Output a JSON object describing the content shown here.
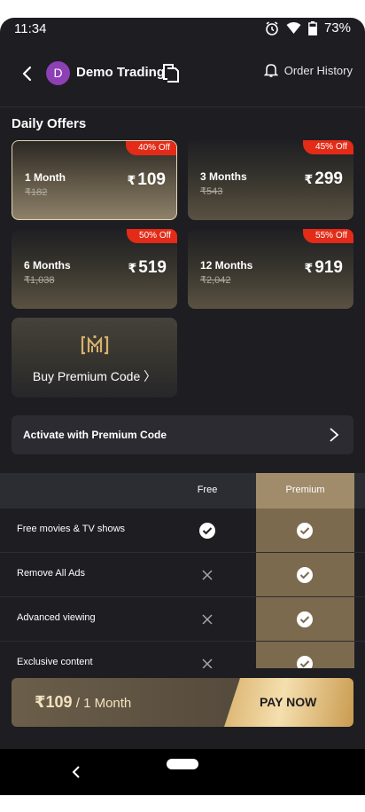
{
  "status_bar": {
    "time": "11:34",
    "battery": "73%"
  },
  "header": {
    "avatar_letter": "D",
    "account_name": "Demo Trading",
    "order_history": "Order History"
  },
  "daily_offers": {
    "title": "Daily Offers",
    "offers": [
      {
        "badge": "40% Off",
        "duration": "1 Month",
        "old_price": "₹182",
        "price": "109",
        "selected": true
      },
      {
        "badge": "45% Off",
        "duration": "3 Months",
        "old_price": "₹543",
        "price": "299",
        "selected": false
      },
      {
        "badge": "50% Off",
        "duration": "6 Months",
        "old_price": "₹1,038",
        "price": "519",
        "selected": false
      },
      {
        "badge": "55% Off",
        "duration": "12 Months",
        "old_price": "₹2,042",
        "price": "919",
        "selected": false
      }
    ],
    "currency_symbol": "₹",
    "buy_premium_code": "Buy Premium Code 〉"
  },
  "activate": {
    "label": "Activate with Premium Code"
  },
  "comparison": {
    "columns": {
      "free": "Free",
      "premium": "Premium"
    },
    "rows": [
      {
        "feature": "Free movies & TV shows",
        "free": true,
        "premium": true
      },
      {
        "feature": "Remove All Ads",
        "free": false,
        "premium": true
      },
      {
        "feature": "Advanced viewing",
        "free": false,
        "premium": true
      },
      {
        "feature": "Exclusive content",
        "free": false,
        "premium": true
      }
    ]
  },
  "pay_bar": {
    "price": "₹109",
    "period": " / 1 Month",
    "button": "PAY NOW"
  },
  "icons": {
    "back": "back-arrow-icon",
    "copy": "copy-icon",
    "bell": "bell-icon",
    "check": "check-circle-icon",
    "cross": "cross-icon",
    "chevron": "chevron-right-icon",
    "premium_logo": "premium-logo-icon",
    "alarm": "alarm-icon",
    "wifi": "wifi-icon",
    "battery": "battery-icon"
  },
  "colors": {
    "accent_gold": "#d9b26d",
    "badge_red": "#e32b17",
    "premium_col": "#7c6a4f",
    "avatar": "#8d3fb5"
  }
}
